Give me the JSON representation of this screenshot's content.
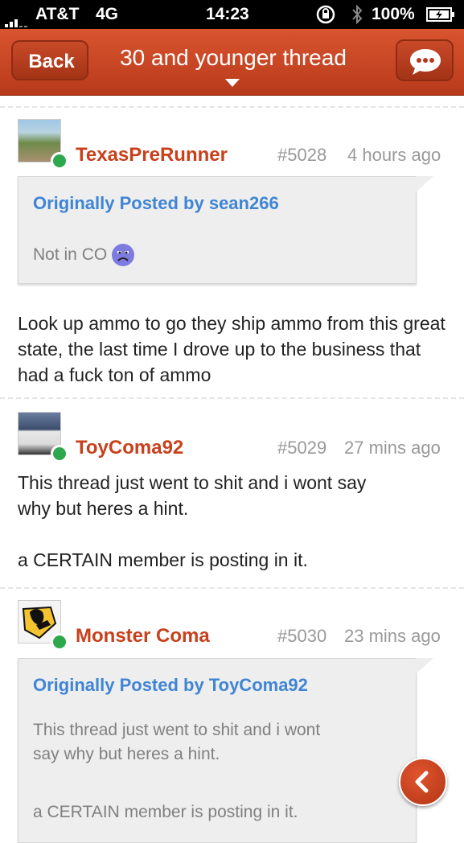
{
  "status_bar": {
    "carrier": "AT&T",
    "network": "4G",
    "time": "14:23",
    "battery": "100%"
  },
  "nav": {
    "back_label": "Back",
    "title": "30 and younger thread"
  },
  "posts": [
    {
      "username": "TexasPreRunner",
      "number": "#5028",
      "time": "4 hours ago",
      "quote": {
        "by": "Originally Posted by sean266",
        "text": "Not in CO"
      },
      "body": "Look up ammo to go they ship ammo from this great state, the last time  I drove up to the business that had a fuck ton of ammo"
    },
    {
      "username": "ToyComa92",
      "number": "#5029",
      "time": "27 mins ago",
      "body_lines": [
        "This thread just went to shit and i wont say",
        "why but heres a hint.",
        "",
        "a CERTAIN member is posting in it."
      ]
    },
    {
      "username": "Monster Coma",
      "number": "#5030",
      "time": "23 mins ago",
      "quote": {
        "by": "Originally Posted by ToyComa92",
        "lines": [
          "This thread just went to shit and i wont",
          "say why but heres a hint.",
          "",
          "a CERTAIN member is posting in it."
        ]
      }
    }
  ],
  "colors": {
    "nav_bar": "#c8451f",
    "username": "#c8401c",
    "quote_author": "#3f85d4",
    "online": "#2ea84d"
  },
  "icons": [
    "chat-bubble-icon",
    "back-arrow-icon",
    "online-indicator-icon",
    "sad-emoji-icon"
  ]
}
